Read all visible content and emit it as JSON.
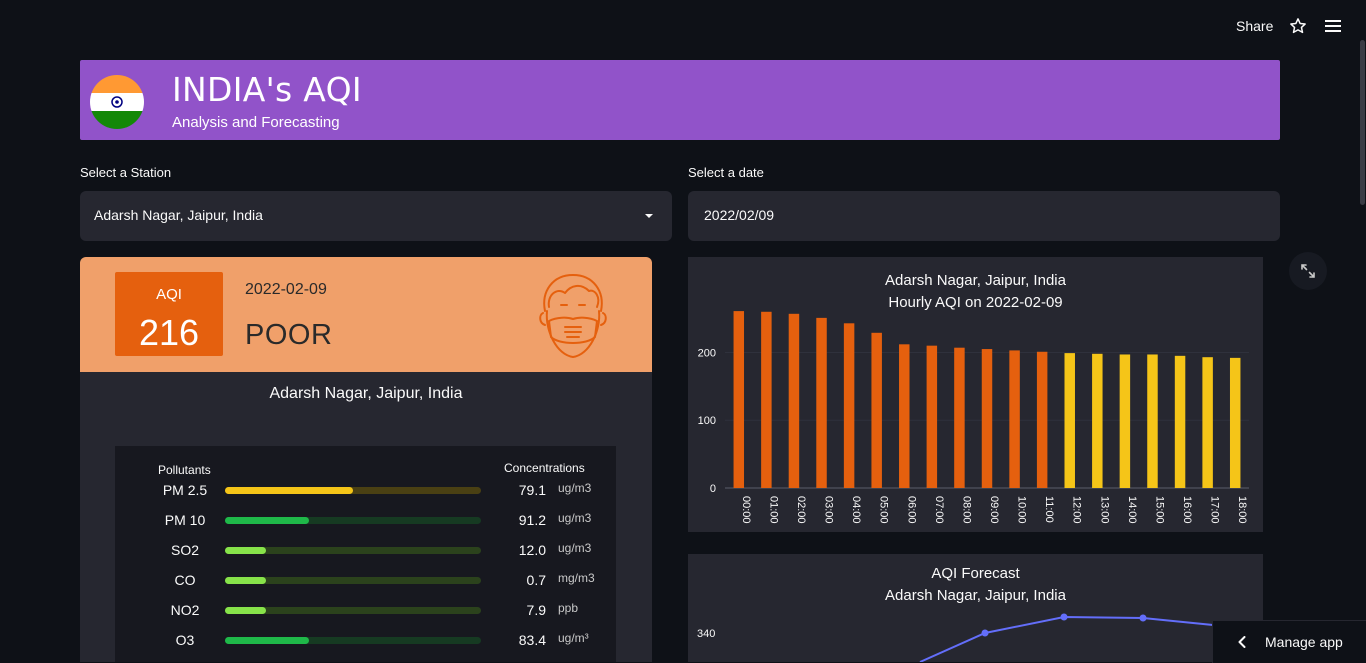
{
  "topbar": {
    "share_label": "Share",
    "star_icon": "star-icon",
    "menu_icon": "hamburger-menu-icon"
  },
  "header": {
    "title": "INDIA's AQI",
    "subtitle": "Analysis and Forecasting",
    "logo": "india-flag-icon"
  },
  "station_select": {
    "label": "Select a Station",
    "value": "Adarsh Nagar, Jaipur, India"
  },
  "date_input": {
    "label": "Select a date",
    "value": "2022/02/09"
  },
  "aqi_card": {
    "aqi_label": "AQI",
    "aqi_value": "216",
    "date": "2022-02-09",
    "category": "POOR",
    "station": "Adarsh Nagar, Jaipur, India",
    "colors": {
      "header_bg": "#f0a06a",
      "badge": "#e5600e"
    },
    "icon": "face-mask-icon"
  },
  "pollutants": {
    "header_name": "Pollutants",
    "header_conc": "Concentrations",
    "items": [
      {
        "name": "PM 2.5",
        "value": "79.1",
        "unit": "ug/m3",
        "level": 0.5,
        "color": "#f5c518",
        "track": "#4a4013"
      },
      {
        "name": "PM 10",
        "value": "91.2",
        "unit": "ug/m3",
        "level": 0.33,
        "color": "#1fb849",
        "track": "#163a22"
      },
      {
        "name": "SO2",
        "value": "12.0",
        "unit": "ug/m3",
        "level": 0.16,
        "color": "#87e34a",
        "track": "#2b421c"
      },
      {
        "name": "CO",
        "value": "0.7",
        "unit": "mg/m3",
        "level": 0.16,
        "color": "#87e34a",
        "track": "#2b421c"
      },
      {
        "name": "NO2",
        "value": "7.9",
        "unit": "ppb",
        "level": 0.16,
        "color": "#87e34a",
        "track": "#2b421c"
      },
      {
        "name": "O3",
        "value": "83.4",
        "unit": "ug/m³",
        "level": 0.33,
        "color": "#1fb849",
        "track": "#163a22"
      }
    ]
  },
  "chart_data": [
    {
      "type": "bar",
      "title": "Adarsh Nagar, Jaipur, India",
      "subtitle": "Hourly AQI on 2022-02-09",
      "categories": [
        "00:00",
        "01:00",
        "02:00",
        "03:00",
        "04:00",
        "05:00",
        "06:00",
        "07:00",
        "08:00",
        "09:00",
        "10:00",
        "11:00",
        "12:00",
        "13:00",
        "14:00",
        "15:00",
        "16:00",
        "17:00",
        "18:00"
      ],
      "values": [
        261,
        260,
        257,
        251,
        243,
        229,
        212,
        210,
        207,
        205,
        203,
        201,
        199,
        198,
        197,
        197,
        195,
        193,
        192
      ],
      "bar_colors": [
        "#e5600e",
        "#e5600e",
        "#e5600e",
        "#e5600e",
        "#e5600e",
        "#e5600e",
        "#e5600e",
        "#e5600e",
        "#e5600e",
        "#e5600e",
        "#e5600e",
        "#e5600e",
        "#f5c518",
        "#f5c518",
        "#f5c518",
        "#f5c518",
        "#f5c518",
        "#f5c518",
        "#f5c518"
      ],
      "yticks": [
        "0",
        "100",
        "200"
      ],
      "ylim": [
        0,
        270
      ]
    },
    {
      "type": "line",
      "title": "AQI Forecast",
      "subtitle": "Adarsh Nagar, Jaipur, India",
      "ytick_visible": "340",
      "series_color": "#636efa"
    }
  ],
  "expand_icon": "expand-icon",
  "manage_app": {
    "label": "Manage app",
    "icon": "chevron-left-icon"
  }
}
